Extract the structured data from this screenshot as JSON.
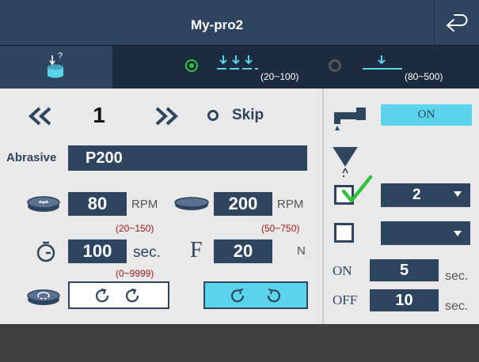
{
  "header": {
    "title": "My-pro2"
  },
  "modes": [
    {
      "range": "(20~100)",
      "selected": true
    },
    {
      "range": "(80~500)",
      "selected": false
    }
  ],
  "step": {
    "number": "1",
    "skip_label": "Skip"
  },
  "abrasive": {
    "label": "Abrasive",
    "value": "P200"
  },
  "speed1": {
    "value": "80",
    "unit": "RPM",
    "range": "(20~150)"
  },
  "speed2": {
    "value": "200",
    "unit": "RPM",
    "range": "(50~750)"
  },
  "time": {
    "value": "100",
    "unit": "sec.",
    "range": "(0~9999)"
  },
  "force": {
    "symbol": "F",
    "value": "20",
    "unit": "N"
  },
  "water": {
    "state": "ON"
  },
  "dispenser1": {
    "checked": true,
    "value": "2"
  },
  "dispenser2": {
    "checked": false,
    "value": ""
  },
  "on": {
    "label": "ON",
    "value": "5",
    "unit": "sec."
  },
  "off": {
    "label": "OFF",
    "value": "10",
    "unit": "sec."
  },
  "colors": {
    "navy": "#2e4560",
    "cyan": "#5bd3ea",
    "green": "#2fc23c",
    "red": "#a01818"
  }
}
